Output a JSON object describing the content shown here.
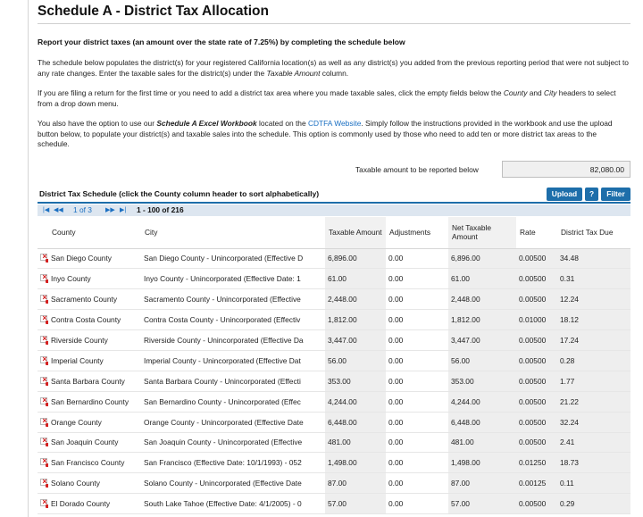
{
  "title": "Schedule A - District Tax Allocation",
  "lead": "Report your district taxes (an amount over the state rate of 7.25%) by completing the schedule below",
  "para1": "The schedule below populates the district(s) for your registered California location(s) as well as any district(s) you added from the previous reporting period that were not subject to any rate changes. Enter the taxable sales for the district(s) under the",
  "para1_em": "Taxable Amount",
  "para1_end": "column.",
  "para2": "If you are filing a return for the first time or you need to add a district tax area where you made taxable sales, click the empty fields below the",
  "para2_em1": "County",
  "para2_and": "and",
  "para2_em2": "City",
  "para2_end": "headers to select from a drop down menu.",
  "para3_a": "You also have the option to use our",
  "para3_strong": "Schedule A Excel Workbook",
  "para3_b": "located on the",
  "para3_link": "CDTFA Website",
  "para3_c": ". Simply follow the instructions provided in the workbook and use the upload button below, to populate your district(s) and taxable sales into the schedule. This option is commonly used by those who need to add ten or more district tax areas to the schedule.",
  "taxable_label": "Taxable amount to be reported below",
  "taxable_value": "82,080.00",
  "schedule_title": "District Tax Schedule (click the County column header to sort alphabetically)",
  "buttons": {
    "upload": "Upload",
    "help": "?",
    "filter": "Filter"
  },
  "pager": {
    "page": "1 of 3",
    "range": "1 - 100 of 216"
  },
  "columns": {
    "county": "County",
    "city": "City",
    "taxable": "Taxable Amount",
    "adjustments": "Adjustments",
    "net_taxable": "Net Taxable Amount",
    "rate": "Rate",
    "due": "District Tax Due"
  },
  "rows": [
    {
      "county": "San Diego County",
      "city": "San Diego County - Unincorporated (Effective D",
      "taxable": "6,896.00",
      "adj": "0.00",
      "net": "6,896.00",
      "rate": "0.00500",
      "due": "34.48"
    },
    {
      "county": "Inyo County",
      "city": "Inyo County - Unincorporated (Effective Date: 1",
      "taxable": "61.00",
      "adj": "0.00",
      "net": "61.00",
      "rate": "0.00500",
      "due": "0.31"
    },
    {
      "county": "Sacramento County",
      "city": "Sacramento County - Unincorporated (Effective",
      "taxable": "2,448.00",
      "adj": "0.00",
      "net": "2,448.00",
      "rate": "0.00500",
      "due": "12.24"
    },
    {
      "county": "Contra Costa County",
      "city": "Contra Costa County - Unincorporated (Effectiv",
      "taxable": "1,812.00",
      "adj": "0.00",
      "net": "1,812.00",
      "rate": "0.01000",
      "due": "18.12"
    },
    {
      "county": "Riverside County",
      "city": "Riverside County - Unincorporated (Effective Da",
      "taxable": "3,447.00",
      "adj": "0.00",
      "net": "3,447.00",
      "rate": "0.00500",
      "due": "17.24"
    },
    {
      "county": "Imperial County",
      "city": "Imperial County - Unincorporated (Effective Dat",
      "taxable": "56.00",
      "adj": "0.00",
      "net": "56.00",
      "rate": "0.00500",
      "due": "0.28"
    },
    {
      "county": "Santa Barbara County",
      "city": "Santa Barbara County - Unincorporated (Effecti",
      "taxable": "353.00",
      "adj": "0.00",
      "net": "353.00",
      "rate": "0.00500",
      "due": "1.77"
    },
    {
      "county": "San Bernardino County",
      "city": "San Bernardino County - Unincorporated (Effec",
      "taxable": "4,244.00",
      "adj": "0.00",
      "net": "4,244.00",
      "rate": "0.00500",
      "due": "21.22"
    },
    {
      "county": "Orange County",
      "city": "Orange County - Unincorporated (Effective Date",
      "taxable": "6,448.00",
      "adj": "0.00",
      "net": "6,448.00",
      "rate": "0.00500",
      "due": "32.24"
    },
    {
      "county": "San Joaquin County",
      "city": "San Joaquin County - Unincorporated (Effective",
      "taxable": "481.00",
      "adj": "0.00",
      "net": "481.00",
      "rate": "0.00500",
      "due": "2.41"
    },
    {
      "county": "San Francisco County",
      "city": "San Francisco (Effective Date: 10/1/1993) - 052",
      "taxable": "1,498.00",
      "adj": "0.00",
      "net": "1,498.00",
      "rate": "0.01250",
      "due": "18.73"
    },
    {
      "county": "Solano County",
      "city": "Solano County - Unincorporated (Effective Date",
      "taxable": "87.00",
      "adj": "0.00",
      "net": "87.00",
      "rate": "0.00125",
      "due": "0.11"
    },
    {
      "county": "El Dorado County",
      "city": "South Lake Tahoe (Effective Date: 4/1/2005) - 0",
      "taxable": "57.00",
      "adj": "0.00",
      "net": "57.00",
      "rate": "0.00500",
      "due": "0.29"
    }
  ]
}
